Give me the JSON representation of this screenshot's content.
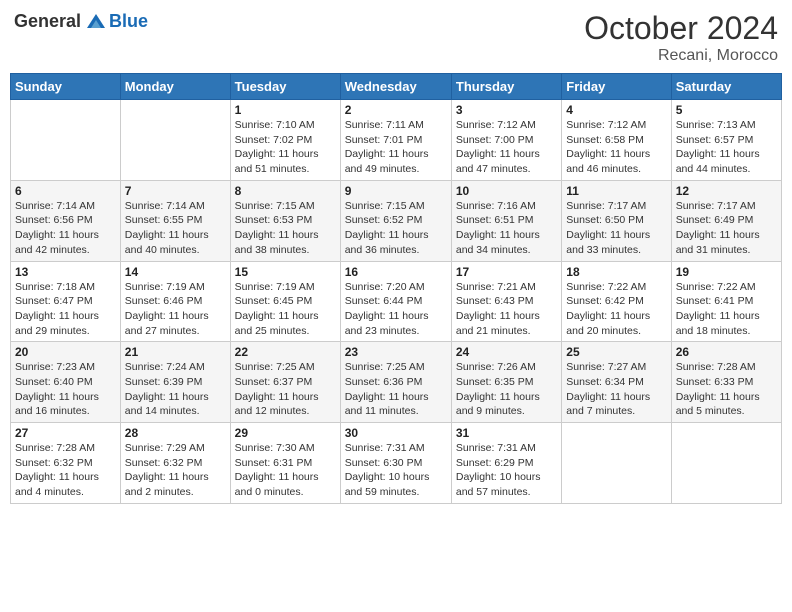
{
  "header": {
    "logo_general": "General",
    "logo_blue": "Blue",
    "month": "October 2024",
    "location": "Recani, Morocco"
  },
  "days_of_week": [
    "Sunday",
    "Monday",
    "Tuesday",
    "Wednesday",
    "Thursday",
    "Friday",
    "Saturday"
  ],
  "weeks": [
    [
      {
        "day": "",
        "info": ""
      },
      {
        "day": "",
        "info": ""
      },
      {
        "day": "1",
        "info": "Sunrise: 7:10 AM\nSunset: 7:02 PM\nDaylight: 11 hours and 51 minutes."
      },
      {
        "day": "2",
        "info": "Sunrise: 7:11 AM\nSunset: 7:01 PM\nDaylight: 11 hours and 49 minutes."
      },
      {
        "day": "3",
        "info": "Sunrise: 7:12 AM\nSunset: 7:00 PM\nDaylight: 11 hours and 47 minutes."
      },
      {
        "day": "4",
        "info": "Sunrise: 7:12 AM\nSunset: 6:58 PM\nDaylight: 11 hours and 46 minutes."
      },
      {
        "day": "5",
        "info": "Sunrise: 7:13 AM\nSunset: 6:57 PM\nDaylight: 11 hours and 44 minutes."
      }
    ],
    [
      {
        "day": "6",
        "info": "Sunrise: 7:14 AM\nSunset: 6:56 PM\nDaylight: 11 hours and 42 minutes."
      },
      {
        "day": "7",
        "info": "Sunrise: 7:14 AM\nSunset: 6:55 PM\nDaylight: 11 hours and 40 minutes."
      },
      {
        "day": "8",
        "info": "Sunrise: 7:15 AM\nSunset: 6:53 PM\nDaylight: 11 hours and 38 minutes."
      },
      {
        "day": "9",
        "info": "Sunrise: 7:15 AM\nSunset: 6:52 PM\nDaylight: 11 hours and 36 minutes."
      },
      {
        "day": "10",
        "info": "Sunrise: 7:16 AM\nSunset: 6:51 PM\nDaylight: 11 hours and 34 minutes."
      },
      {
        "day": "11",
        "info": "Sunrise: 7:17 AM\nSunset: 6:50 PM\nDaylight: 11 hours and 33 minutes."
      },
      {
        "day": "12",
        "info": "Sunrise: 7:17 AM\nSunset: 6:49 PM\nDaylight: 11 hours and 31 minutes."
      }
    ],
    [
      {
        "day": "13",
        "info": "Sunrise: 7:18 AM\nSunset: 6:47 PM\nDaylight: 11 hours and 29 minutes."
      },
      {
        "day": "14",
        "info": "Sunrise: 7:19 AM\nSunset: 6:46 PM\nDaylight: 11 hours and 27 minutes."
      },
      {
        "day": "15",
        "info": "Sunrise: 7:19 AM\nSunset: 6:45 PM\nDaylight: 11 hours and 25 minutes."
      },
      {
        "day": "16",
        "info": "Sunrise: 7:20 AM\nSunset: 6:44 PM\nDaylight: 11 hours and 23 minutes."
      },
      {
        "day": "17",
        "info": "Sunrise: 7:21 AM\nSunset: 6:43 PM\nDaylight: 11 hours and 21 minutes."
      },
      {
        "day": "18",
        "info": "Sunrise: 7:22 AM\nSunset: 6:42 PM\nDaylight: 11 hours and 20 minutes."
      },
      {
        "day": "19",
        "info": "Sunrise: 7:22 AM\nSunset: 6:41 PM\nDaylight: 11 hours and 18 minutes."
      }
    ],
    [
      {
        "day": "20",
        "info": "Sunrise: 7:23 AM\nSunset: 6:40 PM\nDaylight: 11 hours and 16 minutes."
      },
      {
        "day": "21",
        "info": "Sunrise: 7:24 AM\nSunset: 6:39 PM\nDaylight: 11 hours and 14 minutes."
      },
      {
        "day": "22",
        "info": "Sunrise: 7:25 AM\nSunset: 6:37 PM\nDaylight: 11 hours and 12 minutes."
      },
      {
        "day": "23",
        "info": "Sunrise: 7:25 AM\nSunset: 6:36 PM\nDaylight: 11 hours and 11 minutes."
      },
      {
        "day": "24",
        "info": "Sunrise: 7:26 AM\nSunset: 6:35 PM\nDaylight: 11 hours and 9 minutes."
      },
      {
        "day": "25",
        "info": "Sunrise: 7:27 AM\nSunset: 6:34 PM\nDaylight: 11 hours and 7 minutes."
      },
      {
        "day": "26",
        "info": "Sunrise: 7:28 AM\nSunset: 6:33 PM\nDaylight: 11 hours and 5 minutes."
      }
    ],
    [
      {
        "day": "27",
        "info": "Sunrise: 7:28 AM\nSunset: 6:32 PM\nDaylight: 11 hours and 4 minutes."
      },
      {
        "day": "28",
        "info": "Sunrise: 7:29 AM\nSunset: 6:32 PM\nDaylight: 11 hours and 2 minutes."
      },
      {
        "day": "29",
        "info": "Sunrise: 7:30 AM\nSunset: 6:31 PM\nDaylight: 11 hours and 0 minutes."
      },
      {
        "day": "30",
        "info": "Sunrise: 7:31 AM\nSunset: 6:30 PM\nDaylight: 10 hours and 59 minutes."
      },
      {
        "day": "31",
        "info": "Sunrise: 7:31 AM\nSunset: 6:29 PM\nDaylight: 10 hours and 57 minutes."
      },
      {
        "day": "",
        "info": ""
      },
      {
        "day": "",
        "info": ""
      }
    ]
  ]
}
